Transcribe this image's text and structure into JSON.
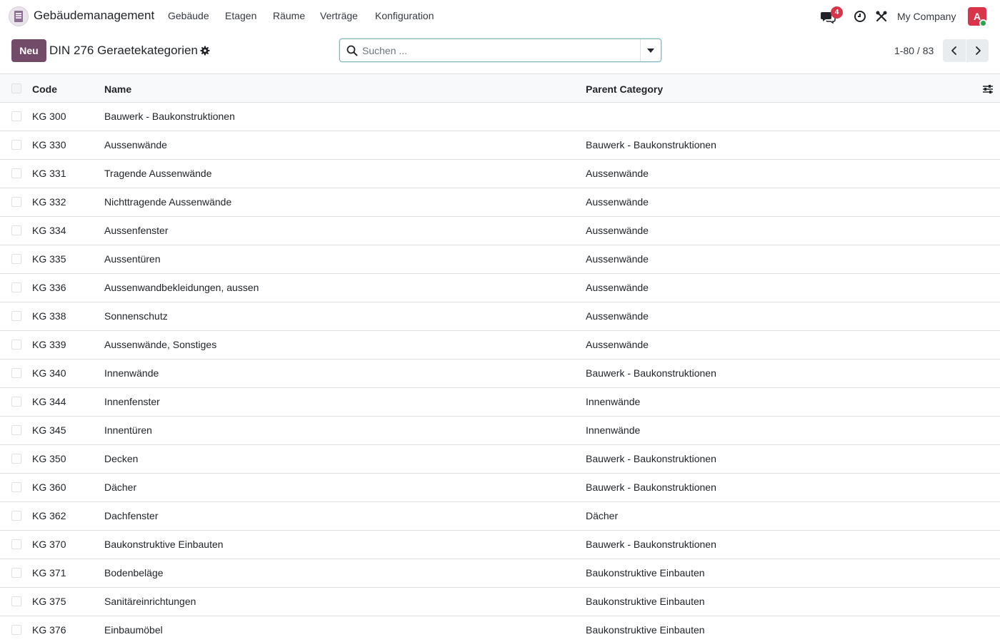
{
  "navbar": {
    "app_name": "Gebäudemanagement",
    "menu": [
      "Gebäude",
      "Etagen",
      "Räume",
      "Verträge",
      "Konfiguration"
    ],
    "messages_count": "4",
    "company": "My Company",
    "avatar_initial": "A",
    "icons": [
      "building-app-icon",
      "chat-icon",
      "clock-icon",
      "debug-tools-icon"
    ]
  },
  "control_panel": {
    "new_label": "Neu",
    "title": "DIN 276 Geraetekategorien",
    "search_placeholder": "Suchen ...",
    "pager": "1-80 / 83"
  },
  "table": {
    "columns": [
      "Code",
      "Name",
      "Parent Category"
    ],
    "rows": [
      {
        "code": "KG 300",
        "name": "Bauwerk - Baukonstruktionen",
        "parent": ""
      },
      {
        "code": "KG 330",
        "name": "Aussenwände",
        "parent": "Bauwerk - Baukonstruktionen"
      },
      {
        "code": "KG 331",
        "name": "Tragende Aussenwände",
        "parent": "Aussenwände"
      },
      {
        "code": "KG 332",
        "name": "Nichttragende Aussenwände",
        "parent": "Aussenwände"
      },
      {
        "code": "KG 334",
        "name": "Aussenfenster",
        "parent": "Aussenwände"
      },
      {
        "code": "KG 335",
        "name": "Aussentüren",
        "parent": "Aussenwände"
      },
      {
        "code": "KG 336",
        "name": "Aussenwandbekleidungen, aussen",
        "parent": "Aussenwände"
      },
      {
        "code": "KG 338",
        "name": "Sonnenschutz",
        "parent": "Aussenwände"
      },
      {
        "code": "KG 339",
        "name": "Aussenwände, Sonstiges",
        "parent": "Aussenwände"
      },
      {
        "code": "KG 340",
        "name": "Innenwände",
        "parent": "Bauwerk - Baukonstruktionen"
      },
      {
        "code": "KG 344",
        "name": "Innenfenster",
        "parent": "Innenwände"
      },
      {
        "code": "KG 345",
        "name": "Innentüren",
        "parent": "Innenwände"
      },
      {
        "code": "KG 350",
        "name": "Decken",
        "parent": "Bauwerk - Baukonstruktionen"
      },
      {
        "code": "KG 360",
        "name": "Dächer",
        "parent": "Bauwerk - Baukonstruktionen"
      },
      {
        "code": "KG 362",
        "name": "Dachfenster",
        "parent": "Dächer"
      },
      {
        "code": "KG 370",
        "name": "Baukonstruktive Einbauten",
        "parent": "Bauwerk - Baukonstruktionen"
      },
      {
        "code": "KG 371",
        "name": "Bodenbeläge",
        "parent": "Baukonstruktive Einbauten"
      },
      {
        "code": "KG 375",
        "name": "Sanitäreinrichtungen",
        "parent": "Baukonstruktive Einbauten"
      },
      {
        "code": "KG 376",
        "name": "Einbaumöbel",
        "parent": "Baukonstruktive Einbauten"
      }
    ]
  },
  "colors": {
    "brand": "#714b67",
    "badge": "#d9344a",
    "online": "#28a745",
    "search_border": "#80b5bd"
  }
}
